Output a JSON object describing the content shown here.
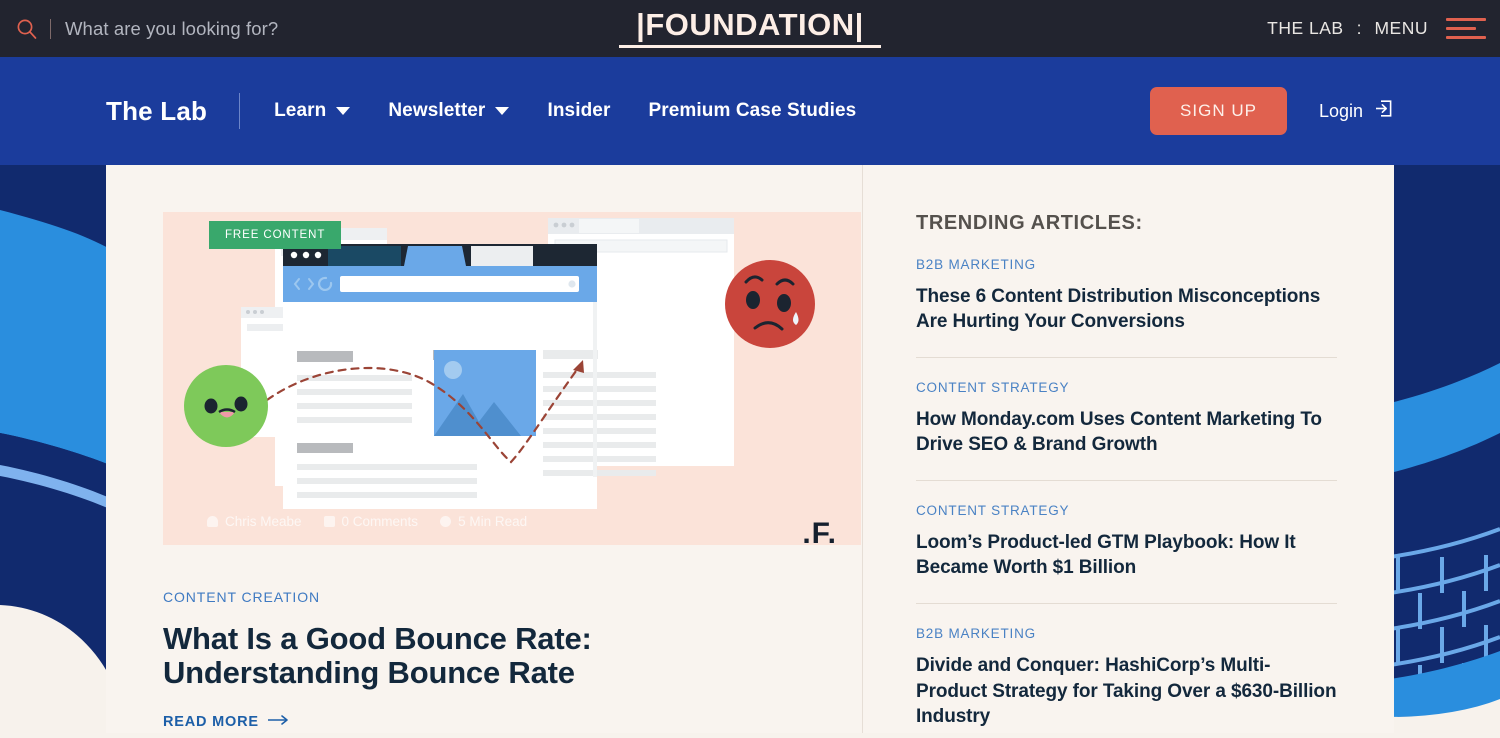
{
  "topbar": {
    "search_placeholder": "What are you looking for?",
    "search_value": "",
    "search_icon": "search-icon",
    "logo": "|FOUNDATION|",
    "the_lab": "THE LAB",
    "separator": ":",
    "menu": "MENU",
    "menu_icon": "hamburger-icon",
    "bg_color": "#22242f",
    "accent_color": "#e0614f"
  },
  "nav": {
    "brand": "The Lab",
    "links": [
      {
        "label": "Learn",
        "has_dropdown": true
      },
      {
        "label": "Newsletter",
        "has_dropdown": true
      },
      {
        "label": "Insider",
        "has_dropdown": false
      },
      {
        "label": "Premium Case Studies",
        "has_dropdown": false
      }
    ],
    "signup_label": "SIGN UP",
    "login_label": "Login",
    "login_icon": "login-arrow-icon",
    "bg_color": "#1b3c9c",
    "signup_color": "#e0614f"
  },
  "featured": {
    "badge": "FREE CONTENT",
    "badge_color": "#39a86c",
    "hero_bg": "#fbe3d9",
    "meta": {
      "author": "Chris Meabe",
      "comments": "0 Comments",
      "read_time": "5 Min Read"
    },
    "watermark": ".F.",
    "category": "CONTENT CREATION",
    "title": "What Is a Good Bounce Rate: Understanding Bounce Rate",
    "read_more": "READ MORE"
  },
  "sidebar": {
    "heading": "TRENDING ARTICLES:",
    "articles": [
      {
        "category": "B2B MARKETING",
        "title": "These 6 Content Distribution Misconceptions Are Hurting Your Conversions"
      },
      {
        "category": "CONTENT STRATEGY",
        "title": "How Monday.com Uses Content Marketing To Drive SEO & Brand Growth"
      },
      {
        "category": "CONTENT STRATEGY",
        "title": "Loom’s Product-led GTM Playbook: How It Became Worth $1 Billion"
      },
      {
        "category": "B2B MARKETING",
        "title": "Divide and Conquer: HashiCorp’s Multi-Product Strategy for Taking Over a $630-Billion Industry"
      }
    ]
  },
  "theme": {
    "panel_bg": "#f9f4ef",
    "page_bg": "#f7f2ec",
    "dark_blue": "#112a6e",
    "mid_blue": "#1b3c9c",
    "light_blue": "#2a8ede",
    "title_color": "#13283c"
  }
}
